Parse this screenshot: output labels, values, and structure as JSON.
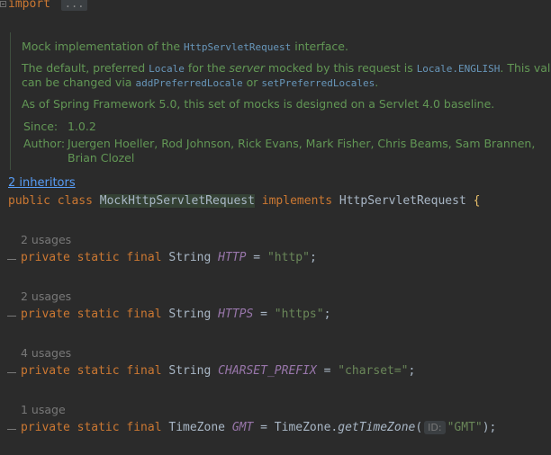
{
  "imports": {
    "keyword": "import",
    "collapsed": "..."
  },
  "javadoc": {
    "line1_pre": "Mock implementation of the ",
    "line1_code": "HttpServletRequest",
    "line1_post": " interface.",
    "line2_pre": "The default, preferred ",
    "line2_code1": "Locale",
    "line2_mid1": " for the ",
    "line2_em": "server",
    "line2_mid2": " mocked by this request is ",
    "line2_code2": "Locale.ENGLISH",
    "line2_post": ". This value",
    "line3_pre": "can be changed via ",
    "line3_code1": "addPreferredLocale",
    "line3_mid": " or ",
    "line3_code2": "setPreferredLocales",
    "line3_post": ".",
    "line4": "As of Spring Framework 5.0, this set of mocks is designed on a Servlet 4.0 baseline.",
    "since_label": "Since:",
    "since_value": "1.0.2",
    "author_label": "Author:",
    "author_line1": "Juergen Hoeller, Rod Johnson, Rick Evans, Mark Fisher, Chris Beams, Sam Brannen,",
    "author_line2": "Brian Clozel"
  },
  "inheritors_link": "2 inheritors",
  "class_decl": {
    "kw_public": "public",
    "kw_class": "class",
    "name": "MockHttpServletRequest",
    "kw_implements": "implements",
    "iface": "HttpServletRequest",
    "brace": "{"
  },
  "fields": [
    {
      "usages": "2 usages",
      "mods": "private static final",
      "type": "String",
      "name": "HTTP",
      "eq": " = ",
      "value": "\"http\"",
      "end": ";"
    },
    {
      "usages": "2 usages",
      "mods": "private static final",
      "type": "String",
      "name": "HTTPS",
      "eq": " = ",
      "value": "\"https\"",
      "end": ";"
    },
    {
      "usages": "4 usages",
      "mods": "private static final",
      "type": "String",
      "name": "CHARSET_PREFIX",
      "eq": " = ",
      "value": "\"charset=\"",
      "end": ";"
    },
    {
      "usages": "1 usage",
      "mods": "private static final",
      "type": "TimeZone",
      "name": "GMT",
      "eq": " = ",
      "call_obj": "TimeZone.",
      "call_method": "getTimeZone",
      "paren_open": "(",
      "hint": "ID:",
      "value": "\"GMT\"",
      "end": ");"
    }
  ]
}
